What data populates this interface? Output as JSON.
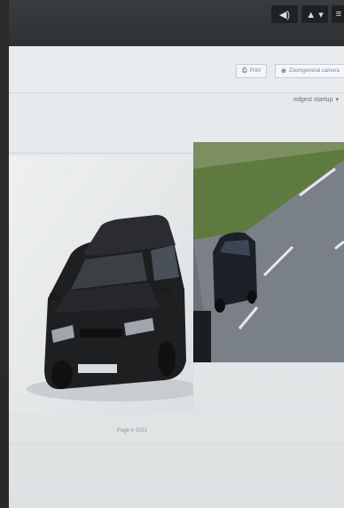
{
  "topbar": {
    "buttons": [
      {
        "icon": "volume-icon",
        "glyph": "◀)"
      },
      {
        "icon": "user-icon",
        "glyph": "▲ ▾"
      },
      {
        "icon": "menu-icon",
        "glyph": "≡"
      }
    ]
  },
  "toolbar": {
    "print_label": "Print",
    "print_icon": "printer-icon",
    "second_label": "Zoomgeneral camera",
    "second_icon": "zoom-icon"
  },
  "filter": {
    "label": "edgest startup"
  },
  "detail": {
    "close_view_image": "vehicle-close-view",
    "camera_view_image": "vehicle-camera-view",
    "plate_text": ""
  },
  "footer": {
    "text": "Page e 2021"
  },
  "colors": {
    "topbar": "#2e3134",
    "link": "#6f8ab0",
    "screen_bg": "#e9ecee"
  }
}
